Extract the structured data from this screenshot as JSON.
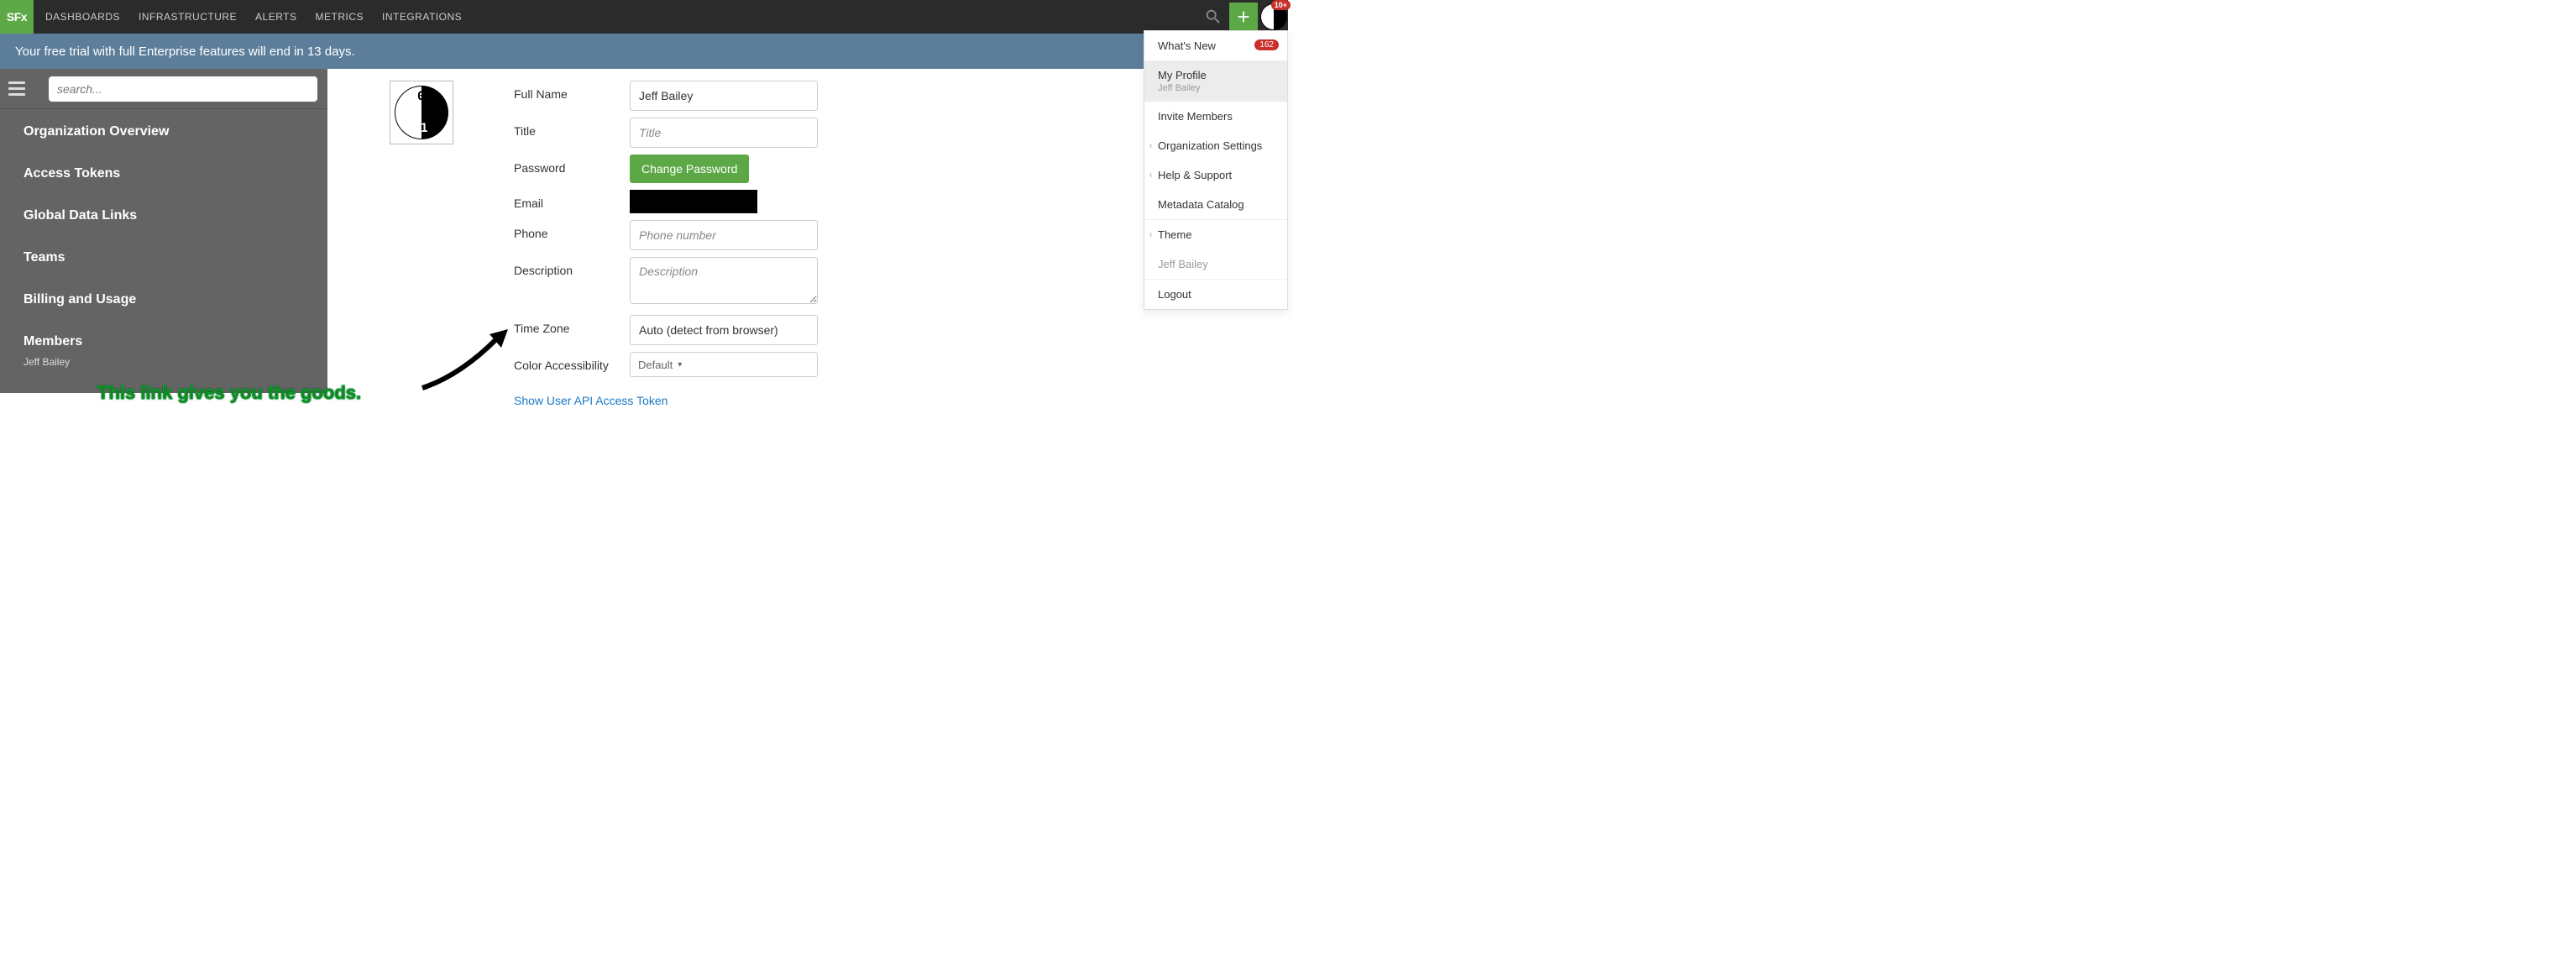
{
  "topnav": {
    "brand": "SFx",
    "links": [
      "DASHBOARDS",
      "INFRASTRUCTURE",
      "ALERTS",
      "METRICS",
      "INTEGRATIONS"
    ],
    "notif_badge": "10+"
  },
  "trial_banner": "Your free trial with full Enterprise features will end in 13 days.",
  "sidebar": {
    "search_placeholder": "search...",
    "items": [
      "Organization Overview",
      "Access Tokens",
      "Global Data Links",
      "Teams",
      "Billing and Usage",
      "Members"
    ],
    "members_sub": "Jeff Bailey"
  },
  "profile": {
    "labels": {
      "full_name": "Full Name",
      "title": "Title",
      "password": "Password",
      "email": "Email",
      "phone": "Phone",
      "description": "Description",
      "timezone": "Time Zone",
      "color": "Color Accessibility"
    },
    "full_name": "Jeff Bailey",
    "title_placeholder": "Title",
    "change_password": "Change Password",
    "phone_placeholder": "Phone number",
    "description_placeholder": "Description",
    "timezone_value": "Auto (detect from browser)",
    "color_value": "Default",
    "api_token_link": "Show User API Access Token"
  },
  "usermenu": {
    "whats_new": "What's New",
    "whats_new_badge": "162",
    "my_profile": "My Profile",
    "my_profile_sub": "Jeff Bailey",
    "invite": "Invite Members",
    "org": "Organization Settings",
    "help": "Help & Support",
    "catalog": "Metadata Catalog",
    "theme": "Theme",
    "footer_user": "Jeff Bailey",
    "logout": "Logout"
  },
  "annotation": "This link gives you the goods."
}
